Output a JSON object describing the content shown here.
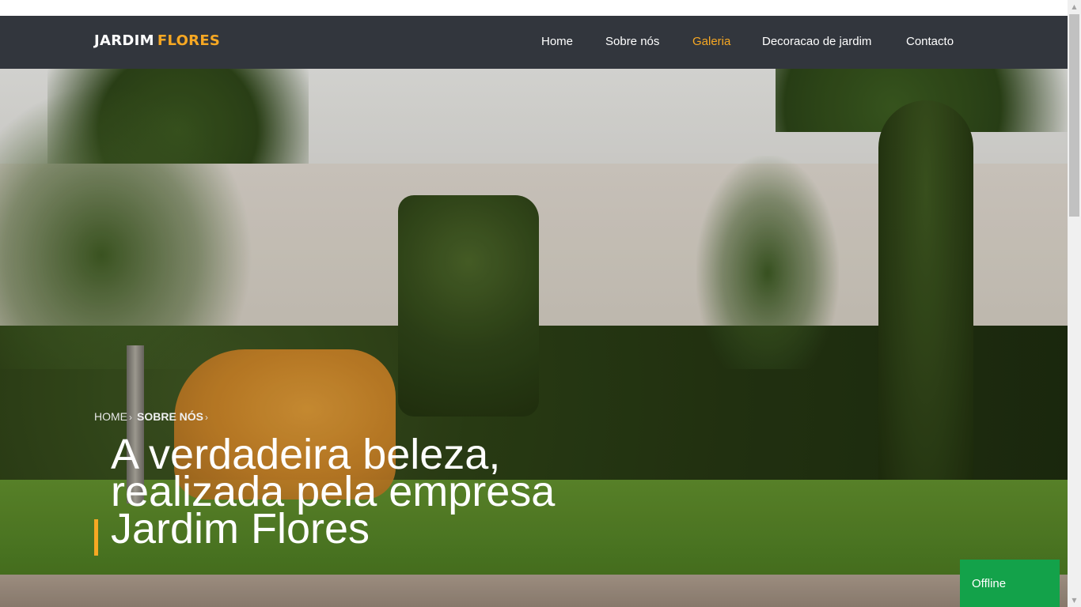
{
  "brand": {
    "name_part1": "JARDIM",
    "name_part2": "FLORES",
    "accent_color": "#f7a823",
    "navbar_color": "#32363d"
  },
  "nav": {
    "items": [
      {
        "label": "Home",
        "active": false
      },
      {
        "label": "Sobre nós",
        "active": false
      },
      {
        "label": "Galeria",
        "active": true
      },
      {
        "label": "Decoracao de jardim",
        "active": false
      },
      {
        "label": "Contacto",
        "active": false
      }
    ]
  },
  "hero": {
    "breadcrumb": [
      {
        "label": "HOME"
      },
      {
        "label": "SOBRE NÓS"
      }
    ],
    "breadcrumb_separator": "›",
    "headline_lines": [
      "A verdadeira beleza,",
      "realizada pela empresa",
      "Jardim Flores"
    ]
  },
  "chat": {
    "status_label": "Offline",
    "color": "#13a24a"
  },
  "scrollbar": {
    "up_icon": "triangle-up-icon",
    "down_icon": "triangle-down-icon"
  }
}
